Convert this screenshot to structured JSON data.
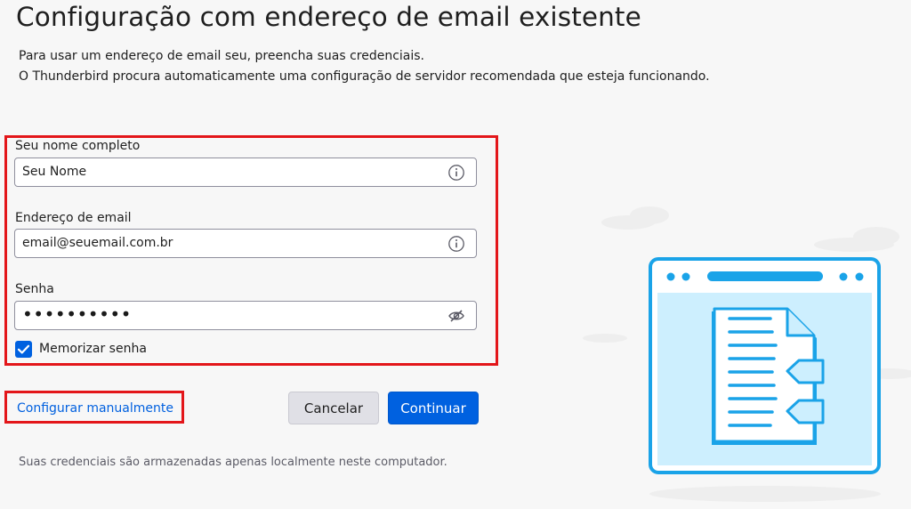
{
  "page": {
    "title": "Configuração com endereço de email existente",
    "description_line1": "Para usar um endereço de email seu, preencha suas credenciais.",
    "description_line2": "O Thunderbird procura automaticamente uma configuração de servidor recomendada que esteja funcionando."
  },
  "form": {
    "name_label": "Seu nome completo",
    "name_value": "Seu Nome",
    "email_label": "Endereço de email",
    "email_value": "email@seuemail.com.br",
    "password_label": "Senha",
    "password_value": "••••••••••",
    "remember_label": "Memorizar senha",
    "remember_checked": true
  },
  "actions": {
    "manual_config": "Configurar manualmente",
    "cancel": "Cancelar",
    "continue": "Continuar"
  },
  "footer": {
    "note": "Suas credenciais são armazenadas apenas localmente neste computador."
  },
  "colors": {
    "accent": "#0061e0",
    "highlight_border": "#e3161a",
    "illustration_blue": "#1aa3e8"
  },
  "icons": {
    "name_info": "info-circle-icon",
    "email_info": "info-circle-icon",
    "password_toggle": "eye-slash-icon",
    "checkbox": "checkmark-icon",
    "illustration": "document-browser-illustration"
  }
}
